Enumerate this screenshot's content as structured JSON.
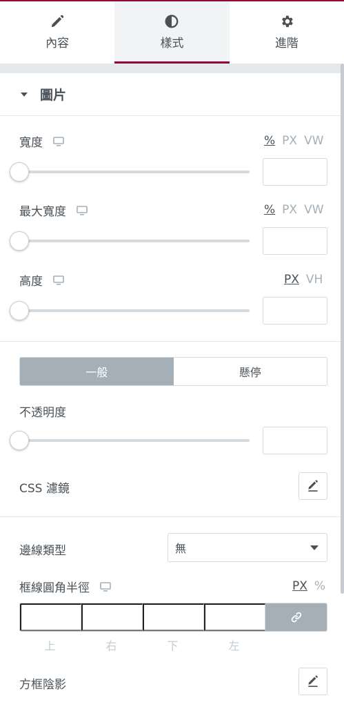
{
  "tabs": [
    {
      "label": "內容",
      "icon": "pencil-icon"
    },
    {
      "label": "樣式",
      "icon": "half-circle-icon",
      "active": true
    },
    {
      "label": "進階",
      "icon": "gear-icon"
    }
  ],
  "section": {
    "title": "圖片"
  },
  "width": {
    "label": "寬度",
    "units": [
      "%",
      "PX",
      "VW"
    ],
    "active_unit": "%",
    "value": ""
  },
  "max_width": {
    "label": "最大寬度",
    "units": [
      "%",
      "PX",
      "VW"
    ],
    "active_unit": "%",
    "value": ""
  },
  "height": {
    "label": "高度",
    "units": [
      "PX",
      "VH"
    ],
    "active_unit": "PX",
    "value": ""
  },
  "state_tabs": [
    {
      "label": "一般",
      "active": true
    },
    {
      "label": "懸停",
      "active": false
    }
  ],
  "opacity": {
    "label": "不透明度",
    "value": ""
  },
  "css_filters": {
    "label": "CSS 濾鏡"
  },
  "border_type": {
    "label": "邊線類型",
    "value": "無"
  },
  "border_radius": {
    "label": "框線圓角半徑",
    "units": [
      "PX",
      "%"
    ],
    "active_unit": "PX",
    "sides": [
      "上",
      "右",
      "下",
      "左"
    ]
  },
  "box_shadow": {
    "label": "方框陰影"
  },
  "colors": {
    "accent": "#93003c",
    "active_gray": "#a4afb7",
    "text": "#495157"
  }
}
